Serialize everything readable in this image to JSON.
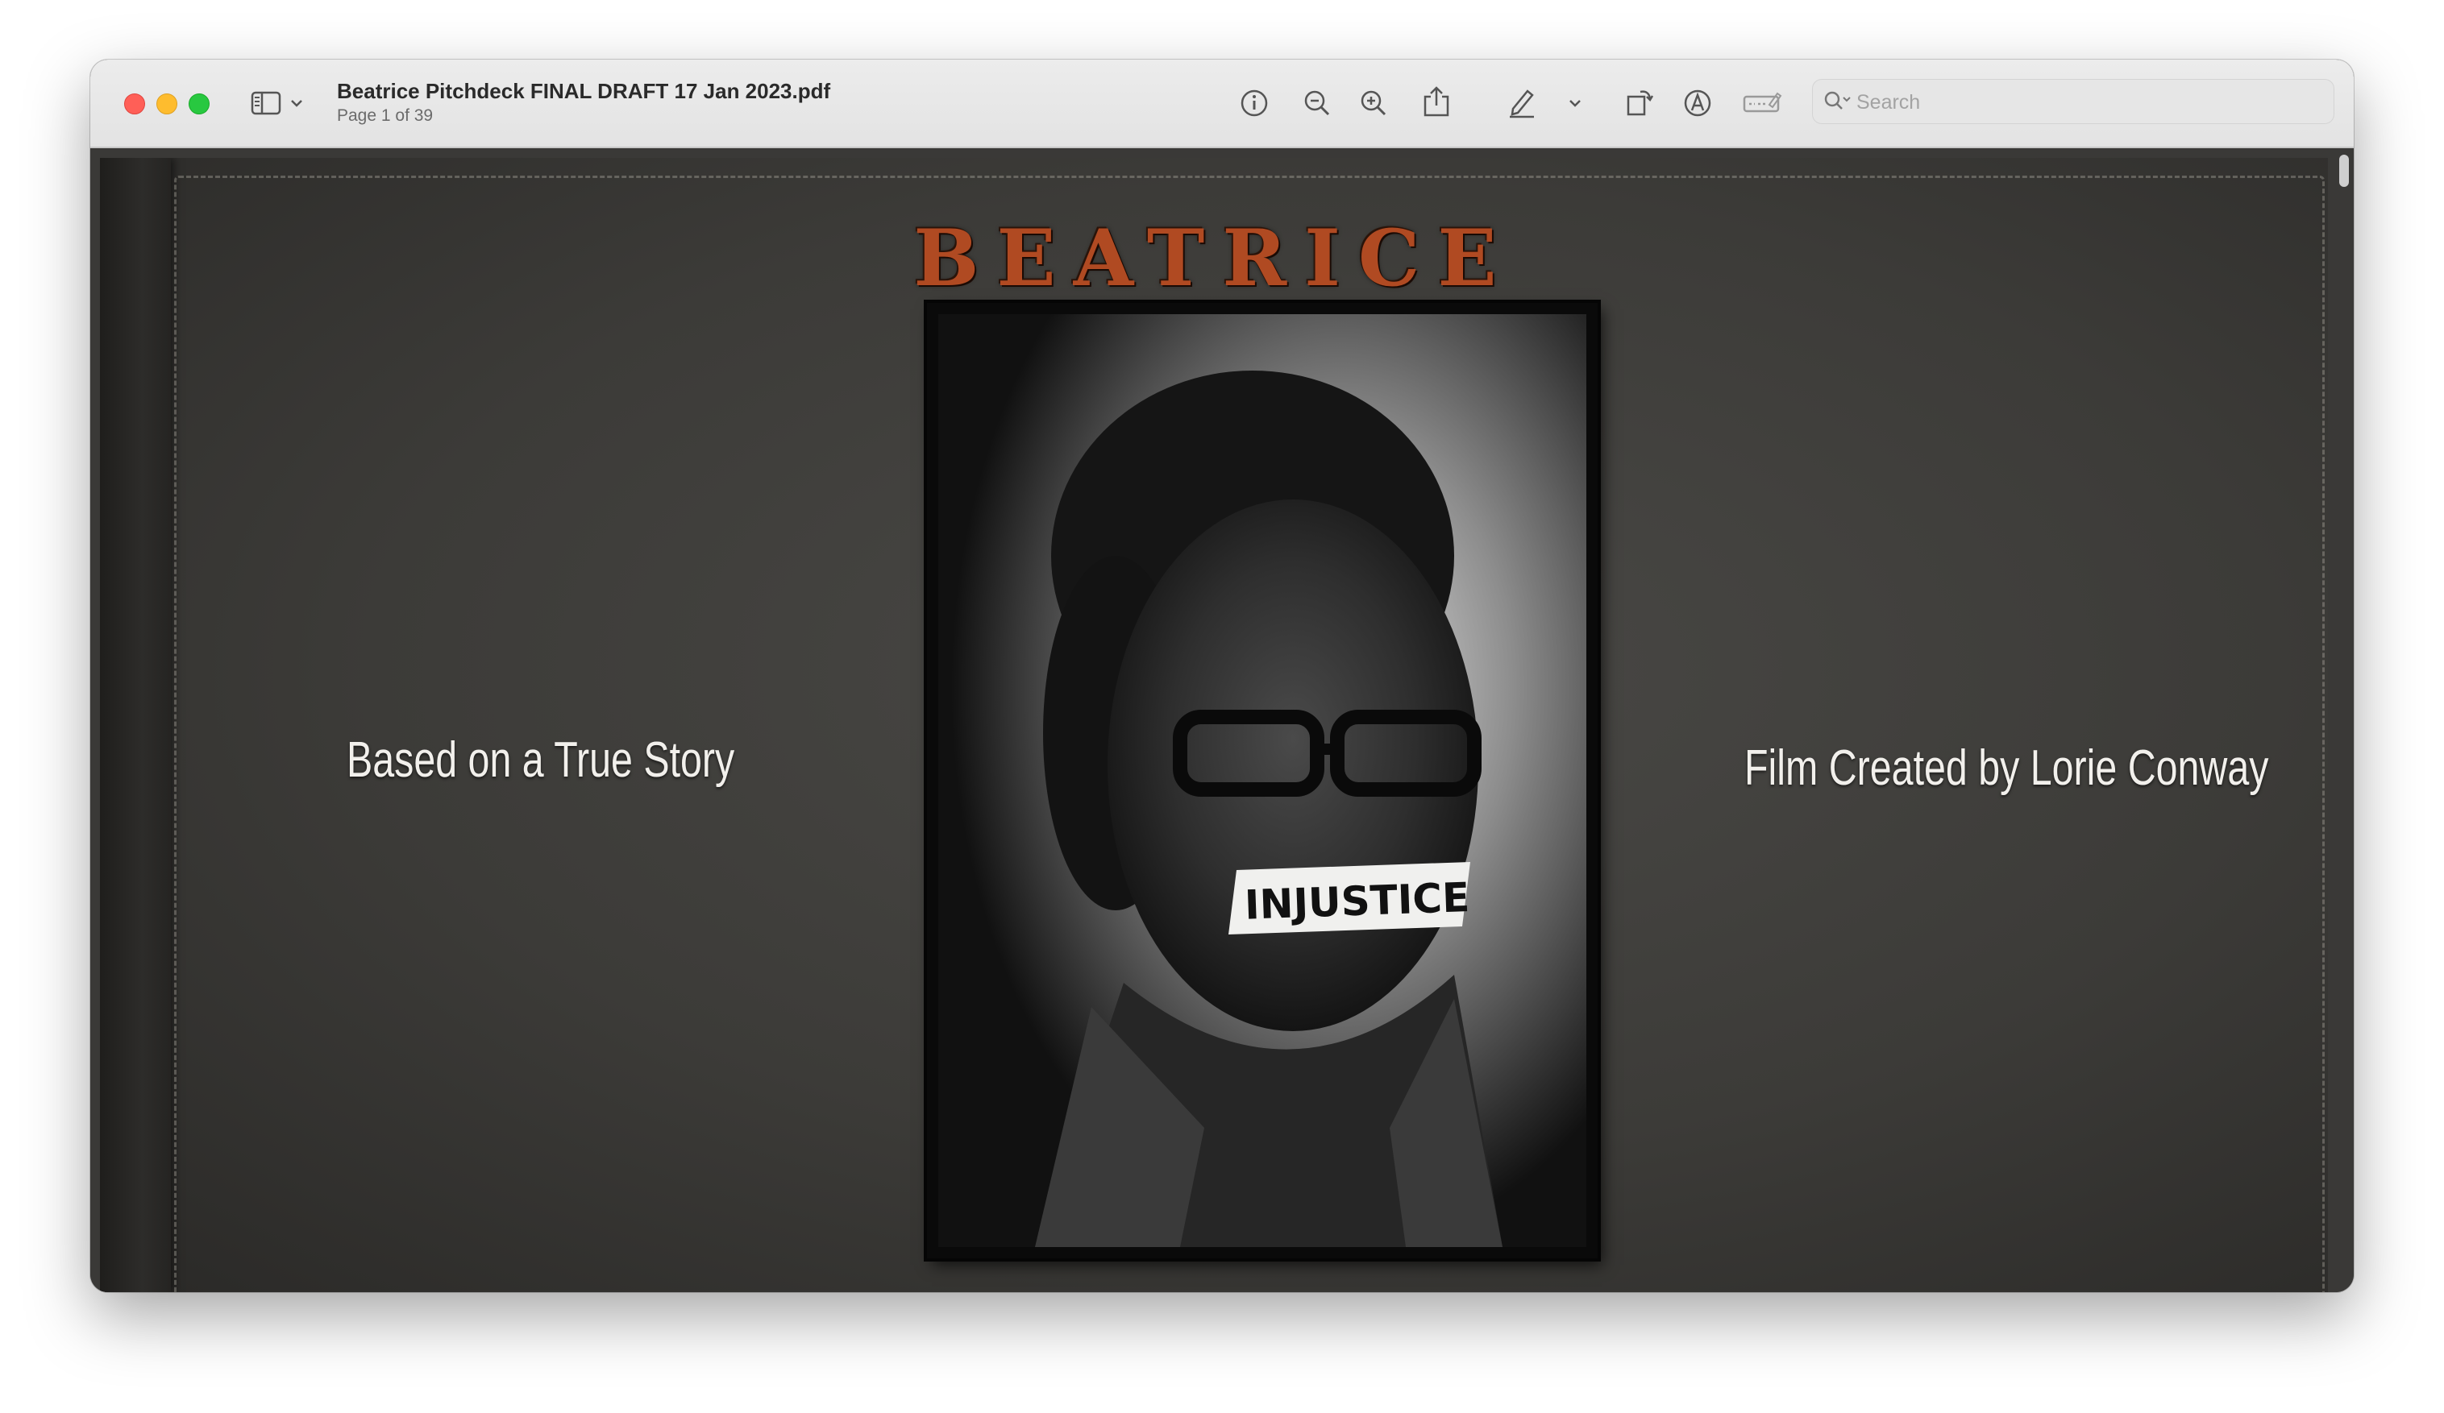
{
  "window": {
    "document_title": "Beatrice Pitchdeck FINAL DRAFT 17 Jan 2023.pdf",
    "page_indicator": "Page 1 of 39"
  },
  "toolbar": {
    "icons": [
      "sidebar-icon",
      "chevron-down-icon",
      "info-icon",
      "zoom-out-icon",
      "zoom-in-icon",
      "share-icon",
      "highlight-pen-icon",
      "chevron-down-icon",
      "rotate-icon",
      "markup-icon",
      "form-fill-icon",
      "search-icon"
    ],
    "search_placeholder": "Search"
  },
  "page": {
    "title": "BEATRICE",
    "left_caption": "Based on a True Story",
    "right_caption": "Film Created by Lorie Conway",
    "photo_label": "INJUSTICE"
  },
  "colors": {
    "title_accent": "#b04a22",
    "close": "#ff5f57",
    "minimize": "#febc2e",
    "maximize": "#28c840"
  }
}
